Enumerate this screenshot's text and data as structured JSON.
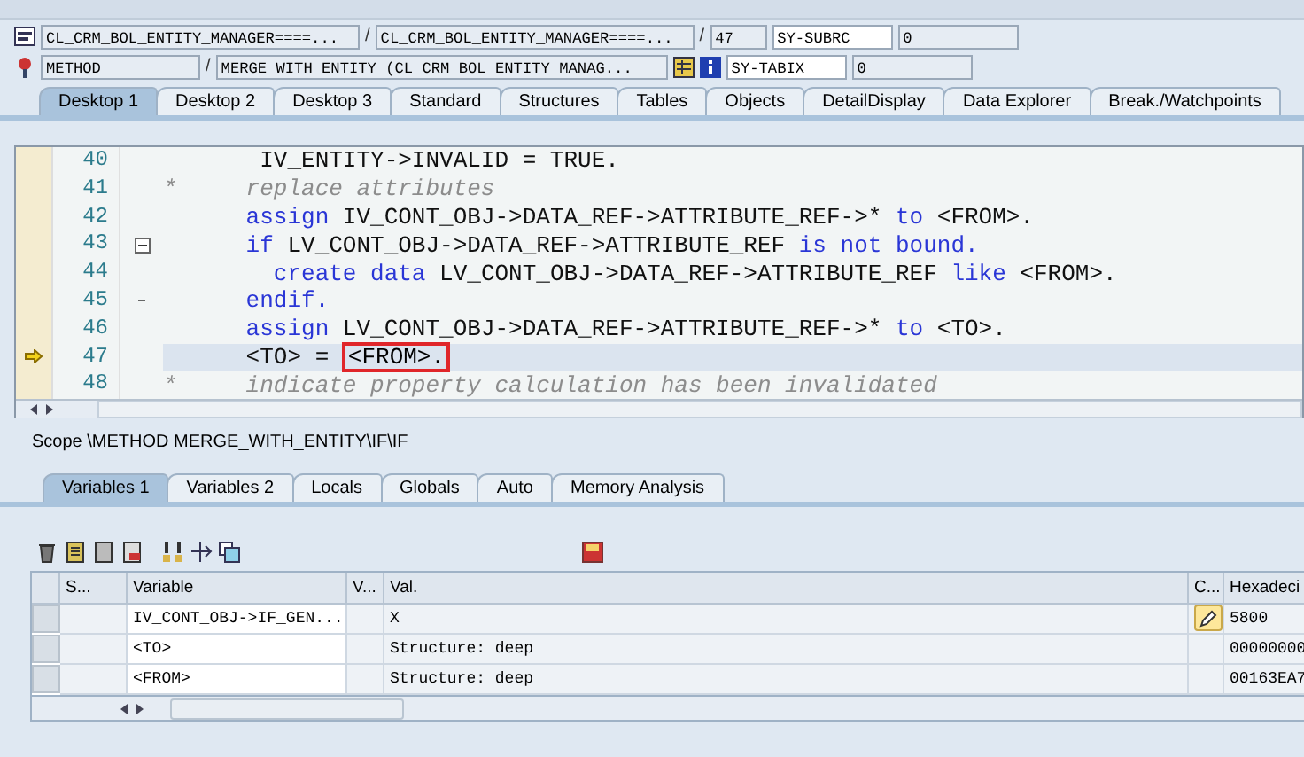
{
  "header": {
    "rows": [
      {
        "kind": "program",
        "first": "CL_CRM_BOL_ENTITY_MANAGER====...",
        "separator_1": "/",
        "second": "CL_CRM_BOL_ENTITY_MANAGER====...",
        "separator_2": "/",
        "third": "47",
        "sys_name": "SY-SUBRC",
        "sys_value": "0"
      },
      {
        "kind": "method",
        "first": "METHOD",
        "separator_1": "/",
        "second": "MERGE_WITH_ENTITY (CL_CRM_BOL_ENTITY_MANAG...",
        "sys_name": "SY-TABIX",
        "sys_value": "0"
      }
    ]
  },
  "desktop_tabs": [
    {
      "label": "Desktop 1",
      "selected": true
    },
    {
      "label": "Desktop 2",
      "selected": false
    },
    {
      "label": "Desktop 3",
      "selected": false
    },
    {
      "label": "Standard",
      "selected": false
    },
    {
      "label": "Structures",
      "selected": false
    },
    {
      "label": "Tables",
      "selected": false
    },
    {
      "label": "Objects",
      "selected": false
    },
    {
      "label": "DetailDisplay",
      "selected": false
    },
    {
      "label": "Data Explorer",
      "selected": false
    },
    {
      "label": "Break./Watchpoints",
      "selected": false
    }
  ],
  "code": [
    {
      "kind": "plain",
      "number": "40",
      "current": false,
      "segments": [
        {
          "kind": "plain",
          "text": "       IV_ENTITY->INVALID = TRUE."
        }
      ]
    },
    {
      "kind": "plain",
      "number": "41",
      "current": false,
      "segments": [
        {
          "kind": "comment",
          "text": "*     replace attributes"
        }
      ]
    },
    {
      "kind": "plain",
      "number": "42",
      "current": false,
      "segments": [
        {
          "kind": "keyword",
          "text": "      assign"
        },
        {
          "kind": "plain",
          "text": " IV_CONT_OBJ->DATA_REF->ATTRIBUTE_REF->* "
        },
        {
          "kind": "keyword",
          "text": "to"
        },
        {
          "kind": "plain",
          "text": " <FROM>."
        }
      ]
    },
    {
      "kind": "block_start",
      "number": "43",
      "current": false,
      "segments": [
        {
          "kind": "keyword",
          "text": "      if"
        },
        {
          "kind": "plain",
          "text": " LV_CONT_OBJ->DATA_REF->ATTRIBUTE_REF "
        },
        {
          "kind": "keyword",
          "text": "is not bound."
        }
      ]
    },
    {
      "kind": "plain",
      "number": "44",
      "current": false,
      "segments": [
        {
          "kind": "keyword",
          "text": "        create data"
        },
        {
          "kind": "plain",
          "text": " LV_CONT_OBJ->DATA_REF->ATTRIBUTE_REF "
        },
        {
          "kind": "keyword",
          "text": "like"
        },
        {
          "kind": "plain",
          "text": " <FROM>."
        }
      ]
    },
    {
      "kind": "block_end",
      "number": "45",
      "current": false,
      "segments": [
        {
          "kind": "keyword",
          "text": "      endif."
        }
      ]
    },
    {
      "kind": "plain",
      "number": "46",
      "current": false,
      "segments": [
        {
          "kind": "keyword",
          "text": "      assign"
        },
        {
          "kind": "plain",
          "text": " LV_CONT_OBJ->DATA_REF->ATTRIBUTE_REF->* "
        },
        {
          "kind": "keyword",
          "text": "to"
        },
        {
          "kind": "plain",
          "text": " <TO>."
        }
      ]
    },
    {
      "kind": "plain",
      "number": "47",
      "current": true,
      "segments": [
        {
          "kind": "plain",
          "text": "      <TO> = "
        },
        {
          "kind": "boxed",
          "text": "<FROM>."
        }
      ]
    },
    {
      "kind": "plain",
      "number": "48",
      "current": false,
      "segments": [
        {
          "kind": "comment",
          "text": "*     indicate property calculation has been invalidated"
        }
      ]
    }
  ],
  "scope": "Scope \\METHOD MERGE_WITH_ENTITY\\IF\\IF",
  "variable_tabs": [
    {
      "label": "Variables 1",
      "selected": true
    },
    {
      "label": "Variables 2",
      "selected": false
    },
    {
      "label": "Locals",
      "selected": false
    },
    {
      "label": "Globals",
      "selected": false
    },
    {
      "label": "Auto",
      "selected": false
    },
    {
      "label": "Memory Analysis",
      "selected": false
    }
  ],
  "table": {
    "columns": [
      "S...",
      "Variable",
      "V...",
      "Val.",
      "C...",
      "Hexadeci"
    ],
    "rows": [
      {
        "variable": "IV_CONT_OBJ->IF_GEN...",
        "value": "X",
        "editable": true,
        "hex": "5800"
      },
      {
        "variable": "<TO>",
        "value": "Structure: deep",
        "editable": false,
        "hex": "00000000"
      },
      {
        "variable": "<FROM>",
        "value": "Structure: deep",
        "editable": false,
        "hex": "00163EA7"
      }
    ]
  }
}
